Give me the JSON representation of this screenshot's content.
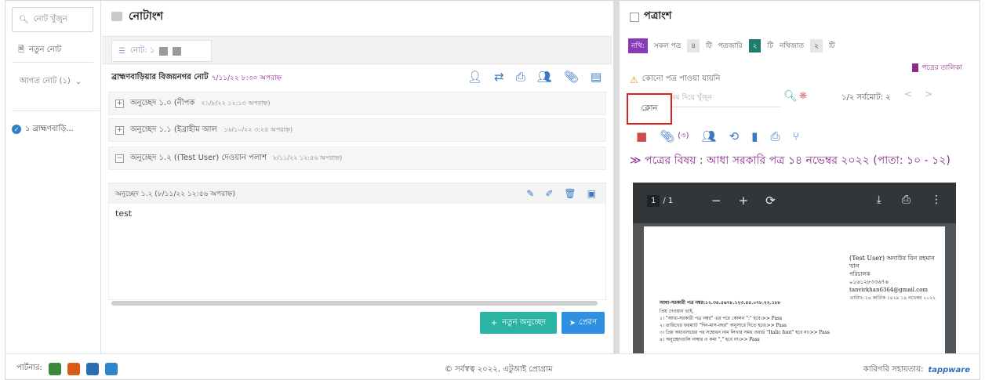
{
  "sidebar": {
    "search_placeholder": "নোট খুঁজুন",
    "new_note_label": "নতুন নোট",
    "folder_label": "আগত নোট (১)",
    "item_label": "১ ব্রাহ্মণবাড়ি..."
  },
  "notes": {
    "header_title": "নোটাংশ",
    "tab_label": "নোট: ১",
    "title_main": "ব্রাহ্মণবাড়িয়ার বিজয়নগর নোট",
    "title_date": "৭/১১/২২ ৮:৩০ অপরাহ্ন",
    "paragraphs": [
      {
        "label": "অনুচ্ছেদ ১.০ (নীপক",
        "date": "২১/৮/২২ ১২:১৩ অপরাহ্ন)"
      },
      {
        "label": "অনুচ্ছেদ ১.১ (ইব্রাহীম আল",
        "date": "১৬/১০/২২ ৩:২৪ অপরাহ্ন)"
      },
      {
        "label": "অনুচ্ছেদ ১.২ ((Test User) দেওয়ান পলাশ",
        "date": "৮/১১/২২ ১২:৫৬ অপরাহ্ন)"
      }
    ],
    "open_para_head": "অনুচ্ছেদ ১.২ (৮/১১/২২ ১২:৫৬ অপরাহ্ন)",
    "open_para_text": "test",
    "add_button": "নতুন অনুচ্ছেদ",
    "send_button": "প্রেরণ"
  },
  "letter": {
    "header_title": "পত্রাংশ",
    "filter_tag": "নথি:",
    "filters": [
      {
        "label": "সকল পত্র",
        "count": "৪",
        "unit": "টি"
      },
      {
        "label": "পত্রজারি",
        "count": "২",
        "unit": "টি"
      },
      {
        "label": "নথিজাত",
        "count": "২",
        "unit": "টি"
      }
    ],
    "list_link": "পত্রের তালিকা",
    "warning": "কোনো পত্র পাওয়া যায়নি",
    "search_placeholder": "বিষয় দিয়ে খুঁজুন",
    "pager": "১/২ সর্বমোট: ২",
    "tooltip": "ক্লোন",
    "attach_count": "(৩)",
    "subject": "≫ পত্রের বিষয় : আধা সরকারি পত্র ১৪ নভেম্বর ২০২২ (পাতা: ১০ - ১২)",
    "pdf": {
      "page": "1",
      "total": "/ 1",
      "sender_name": "(Test User) অনাউর বিন রহমান খান",
      "sender_role": "পরিচালক",
      "sender_phone": "০১৬১২৮৩৩৬৭৬",
      "sender_email": "tanvirkhan6364@gmail.com",
      "ref": "আধা-সরকারী পত্র নম্বর:১২.৩৪.৫৬৭৮.১২৩.৪৫.০৭৮.২২.১৮৮",
      "date": "তারিখ: ২৪ কার্তিক ১৪২৯  ১৪ নভেম্বর ২০২২",
      "lines": [
        "প্রিয় দেওয়ান ভাই,",
        "১। \"আধা-সরকারী পত্র নম্বর\" এর পরে কোলন \":\" হবে।>> Pass",
        "২। তারিখের ফরম্যাট \"দিন-মাস-বছর\" অনুসারে দিতে হবে।>> Pass",
        "৩। প্রিয় অধ্যবসায়ের পর সম্বোধন নাম লিখার সময় ওয়ার্ড \"Italic font\" হবে না।>> Pass",
        "৪। অনুচ্ছেদগুলি নাম্বার ও কমা \",\" হবে না।>> Pass"
      ]
    }
  },
  "footer": {
    "partner_label": "পার্টনার:",
    "copyright": "© সর্বস্বত্ব ২০২২, এটুআই প্রোগ্রাম",
    "tech_label": "কারিগরি সহায়তায়:",
    "tech_brand": "tappware"
  }
}
